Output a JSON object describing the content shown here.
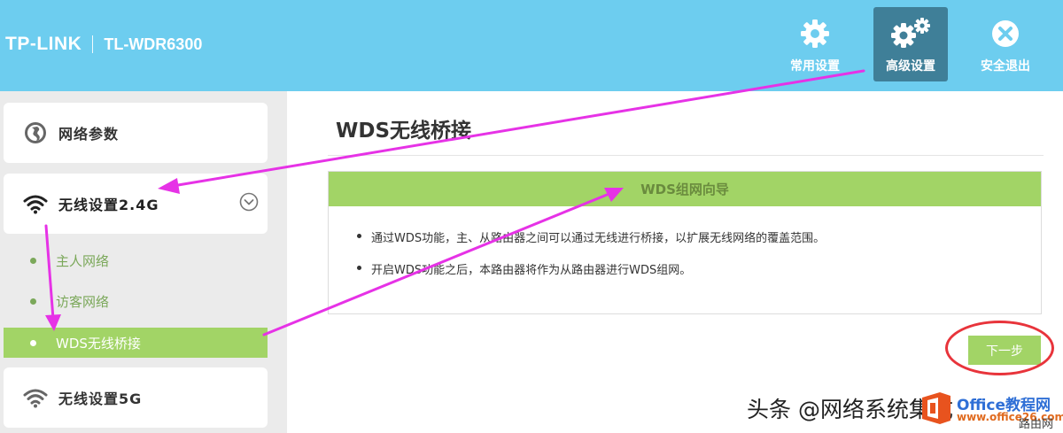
{
  "header": {
    "brand": "TP-LINK",
    "model": "TL-WDR6300",
    "nav": [
      {
        "label": "常用设置",
        "icon": "gear-icon"
      },
      {
        "label": "高级设置",
        "icon": "gears-icon",
        "active": true
      },
      {
        "label": "安全退出",
        "icon": "close-circle-icon"
      }
    ]
  },
  "sidebar": {
    "items": [
      {
        "label": "网络参数",
        "icon": "globe-icon"
      },
      {
        "label": "无线设置2.4G",
        "icon": "wifi-icon",
        "expanded": true,
        "children": [
          {
            "label": "主人网络"
          },
          {
            "label": "访客网络"
          },
          {
            "label": "WDS无线桥接",
            "active": true
          }
        ]
      },
      {
        "label": "无线设置5G",
        "icon": "wifi-icon"
      }
    ]
  },
  "main": {
    "title": "WDS无线桥接",
    "panel": {
      "header": "WDS组网向导",
      "bullets": [
        "通过WDS功能，主、从路由器之间可以通过无线进行桥接，以扩展无线网络的覆盖范围。",
        "开启WDS功能之后，本路由器将作为从路由器进行WDS组网。"
      ]
    },
    "next_button": "下一步"
  },
  "watermark": {
    "text": "头条 @网络系统集成",
    "site": "Office教程网",
    "url": "www.office26.com",
    "corner": "路由网"
  },
  "colors": {
    "header_bg": "#6dcdef",
    "nav_active": "#3f7f98",
    "accent_green": "#a2d466",
    "sub_text_green": "#7ba85a",
    "annotation_arrow": "#e632e6",
    "annotation_circle": "#e8343b"
  }
}
